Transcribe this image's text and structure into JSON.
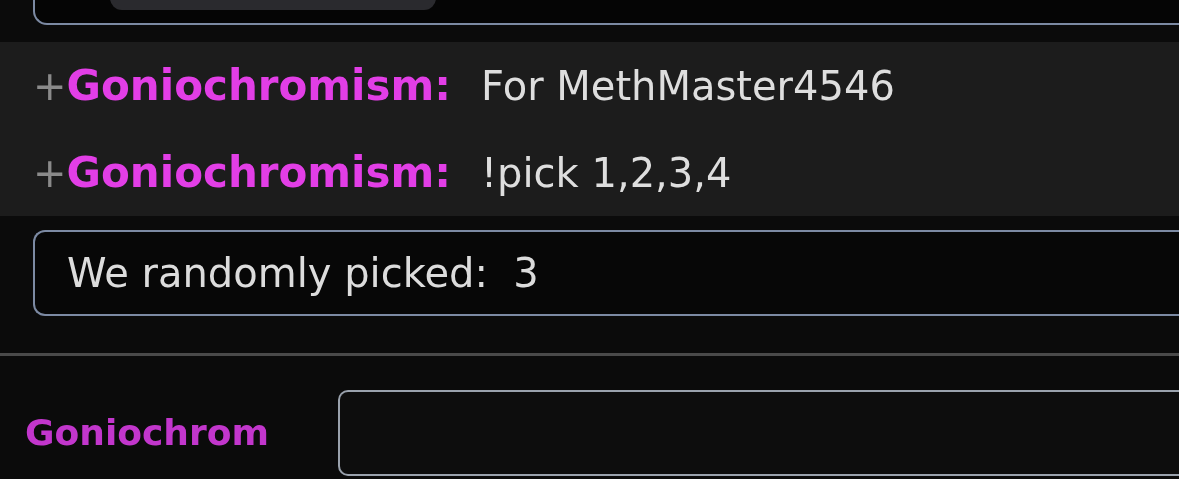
{
  "messages": [
    {
      "prefix": "+",
      "user": "Goniochromism:",
      "text": "For MethMaster4546"
    },
    {
      "prefix": "+",
      "user": "Goniochromism:",
      "text": "!pick 1,2,3,4"
    }
  ],
  "system_message": {
    "text": "We randomly picked:  3"
  },
  "composer": {
    "username": "Goniochrom"
  }
}
